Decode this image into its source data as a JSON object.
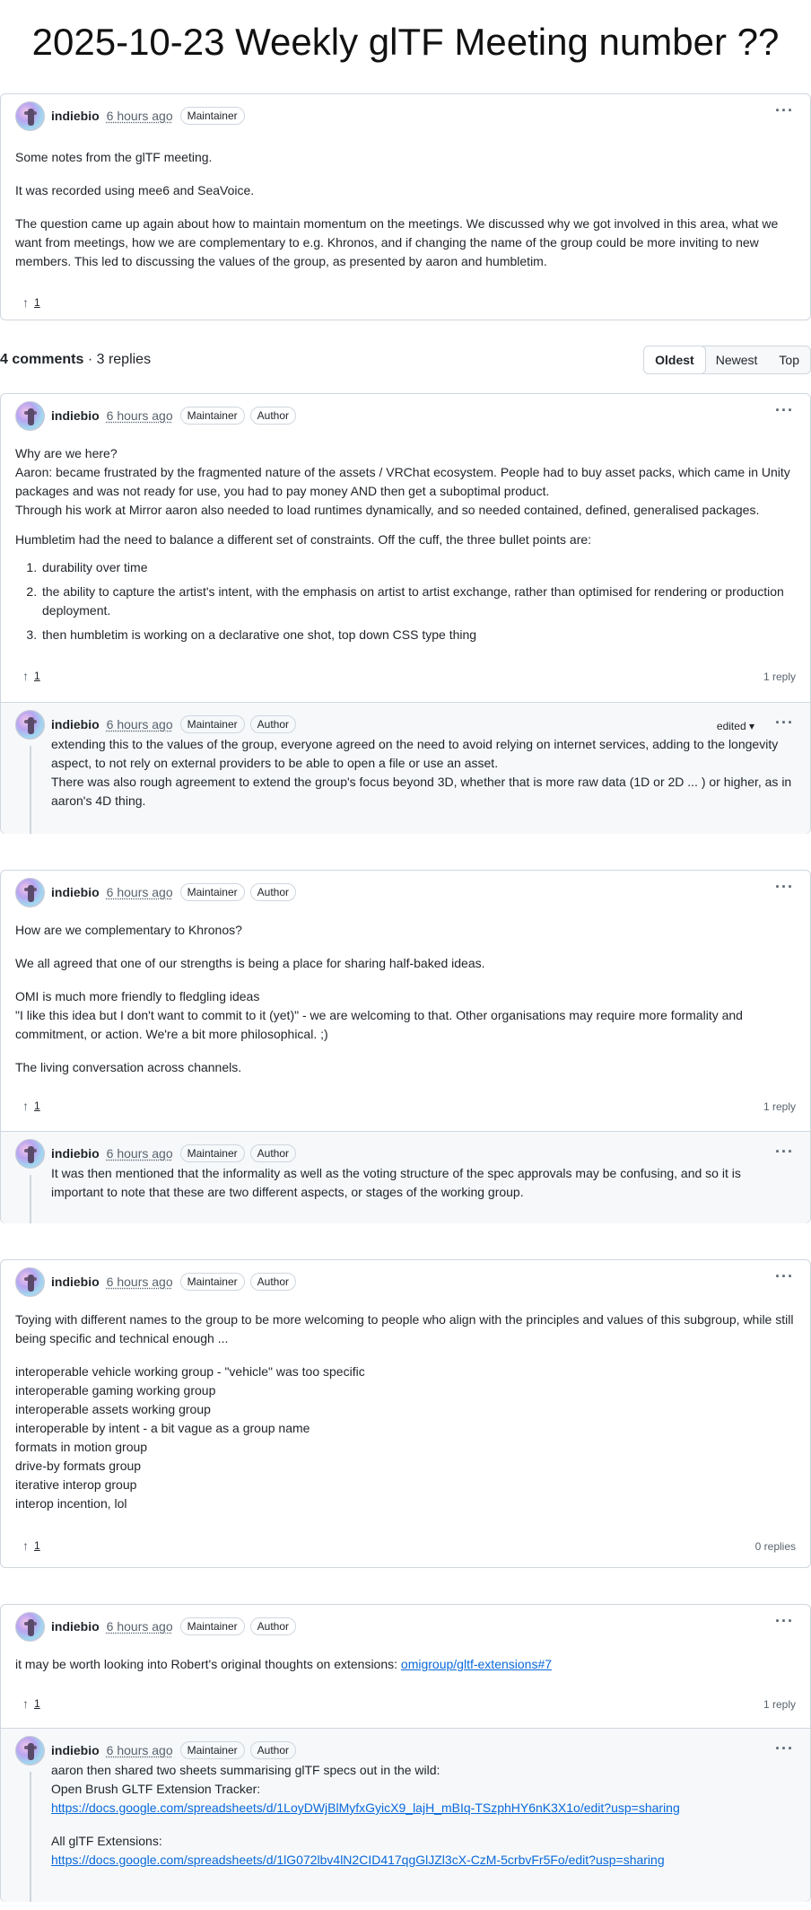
{
  "title": "2025-10-23 Weekly glTF Meeting number ??",
  "post": {
    "author": "indiebio",
    "time": "6 hours ago",
    "badges": [
      "Maintainer"
    ],
    "paragraphs": [
      "Some notes from the glTF meeting.",
      "It was recorded using mee6 and SeaVoice.",
      "The question came up again about how to maintain momentum on the meetings. We discussed why we got involved in this area, what we want from meetings, how we are complementary to e.g. Khronos, and if changing the name of the group could be more inviting to new members. This led to discussing the values of the group, as presented by aaron and humbletim."
    ],
    "upvotes": "1"
  },
  "summary": {
    "comments": "4 comments",
    "replies": "· 3 replies",
    "sort": [
      "Oldest",
      "Newest",
      "Top"
    ]
  },
  "comments": [
    {
      "author": "indiebio",
      "time": "6 hours ago",
      "badges": [
        "Maintainer",
        "Author"
      ],
      "lines_a": [
        "Why are we here?",
        "Aaron: became frustrated by the fragmented nature of the assets / VRChat ecosystem. People had to buy asset packs, which came in Unity packages and was not ready for use, you had to pay money AND then get a suboptimal product.",
        "Through his work at Mirror aaron also needed to load runtimes dynamically, and so needed contained, defined, generalised packages."
      ],
      "para_b": "Humbletim had the need to balance a different set of constraints. Off the cuff, the three bullet points are:",
      "list": [
        "durability over time",
        "the ability to capture the artist's intent, with the emphasis on artist to artist exchange, rather than optimised for rendering or production deployment.",
        "then humbletim is working on a declarative one shot, top down CSS type thing"
      ],
      "upvotes": "1",
      "reply_count": "1 reply",
      "reply": {
        "author": "indiebio",
        "time": "6 hours ago",
        "badges": [
          "Maintainer",
          "Author"
        ],
        "edited": "edited",
        "lines": [
          "extending this to the values of the group, everyone agreed on the need to avoid relying on internet services, adding to the longevity aspect, to not rely on external providers to be able to open a file or use an asset.",
          "There was also rough agreement to extend the group's focus beyond 3D, whether that is more raw data (1D or 2D ... ) or higher, as in aaron's 4D thing."
        ]
      }
    },
    {
      "author": "indiebio",
      "time": "6 hours ago",
      "badges": [
        "Maintainer",
        "Author"
      ],
      "p1": "How are we complementary to Khronos?",
      "p2": "We all agreed that one of our strengths is being a place for sharing half-baked ideas.",
      "p3a": "OMI is much more friendly to fledgling ideas",
      "p3b": "\"I like this idea but I don't want to commit to it (yet)\" - we are welcoming to that. Other organisations may require more formality and commitment, or action. We're a bit more philosophical. ;)",
      "p4": "The living conversation across channels.",
      "upvotes": "1",
      "reply_count": "1 reply",
      "reply": {
        "author": "indiebio",
        "time": "6 hours ago",
        "badges": [
          "Maintainer",
          "Author"
        ],
        "text": "It was then mentioned that the informality as well as the voting structure of the spec approvals may be confusing, and so it is important to note that these are two different aspects, or stages of the working group."
      }
    },
    {
      "author": "indiebio",
      "time": "6 hours ago",
      "badges": [
        "Maintainer",
        "Author"
      ],
      "intro": "Toying with different names to the group to be more welcoming to people who align with the principles and values of this subgroup, while still being specific and technical enough ...",
      "names": [
        "interoperable vehicle working group - \"vehicle\" was too specific",
        "interoperable gaming working group",
        "interoperable assets working group",
        "interoperable by intent - a bit vague as a group name",
        "formats in motion group",
        "drive-by formats group",
        "iterative interop group",
        "interop incention, lol"
      ],
      "upvotes": "1",
      "reply_count": "0 replies"
    },
    {
      "author": "indiebio",
      "time": "6 hours ago",
      "badges": [
        "Maintainer",
        "Author"
      ],
      "text": "it may be worth looking into Robert's original thoughts on extensions:",
      "link": "omigroup/gltf-extensions#7",
      "upvotes": "1",
      "reply_count": "1 reply",
      "reply": {
        "author": "indiebio",
        "time": "6 hours ago",
        "badges": [
          "Maintainer",
          "Author"
        ],
        "l1": "aaron then shared two sheets summarising glTF specs out in the wild:",
        "l2": "Open Brush GLTF Extension Tracker:",
        "link1": "https://docs.google.com/spreadsheets/d/1LoyDWjBlMyfxGyicX9_lajH_mBIq-TSzphHY6nK3X1o/edit?usp=sharing",
        "l3": "All glTF Extensions:",
        "link2": "https://docs.google.com/spreadsheets/d/1lG072lbv4lN2CID417qgGlJZl3cX-CzM-5crbvFr5Fo/edit?usp=sharing"
      }
    }
  ]
}
